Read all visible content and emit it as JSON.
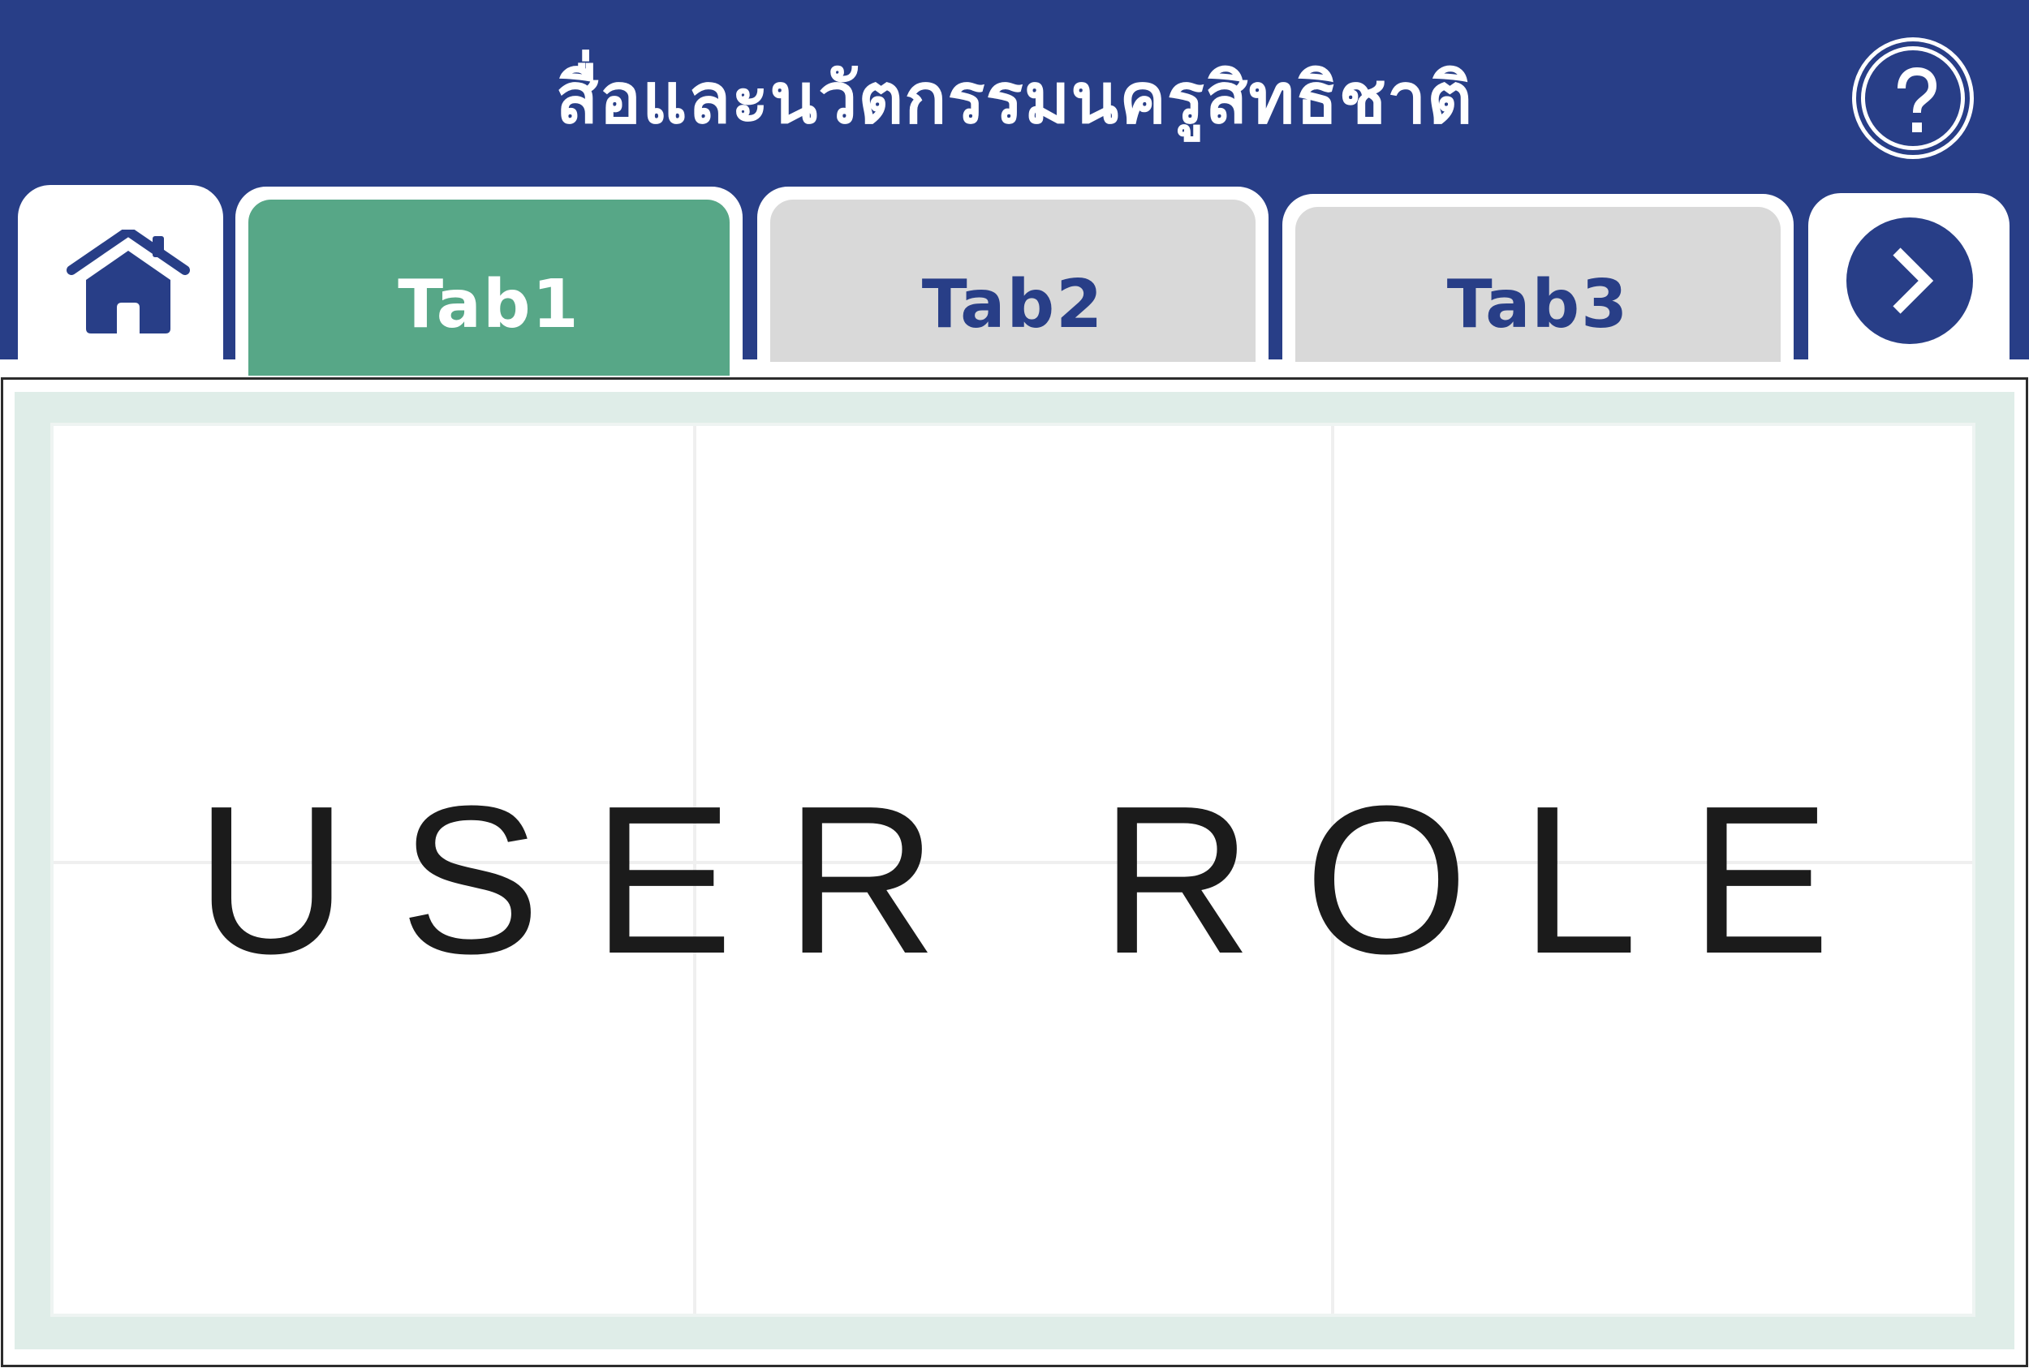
{
  "header": {
    "title": "สื่อและนวัตกรรมนครูสิทธิชาติ",
    "help_icon": "question-circle-icon",
    "background_color": "#283e87"
  },
  "tabs": [
    {
      "label": "Tab1",
      "active": true,
      "color": "#57a787"
    },
    {
      "label": "Tab2",
      "active": false,
      "color": "#d9d9d9"
    },
    {
      "label": "Tab3",
      "active": false,
      "color": "#d9d9d9"
    }
  ],
  "nav": {
    "home_icon": "home-icon",
    "next_icon": "chevron-right-icon"
  },
  "main": {
    "text": "USER ROLE"
  }
}
